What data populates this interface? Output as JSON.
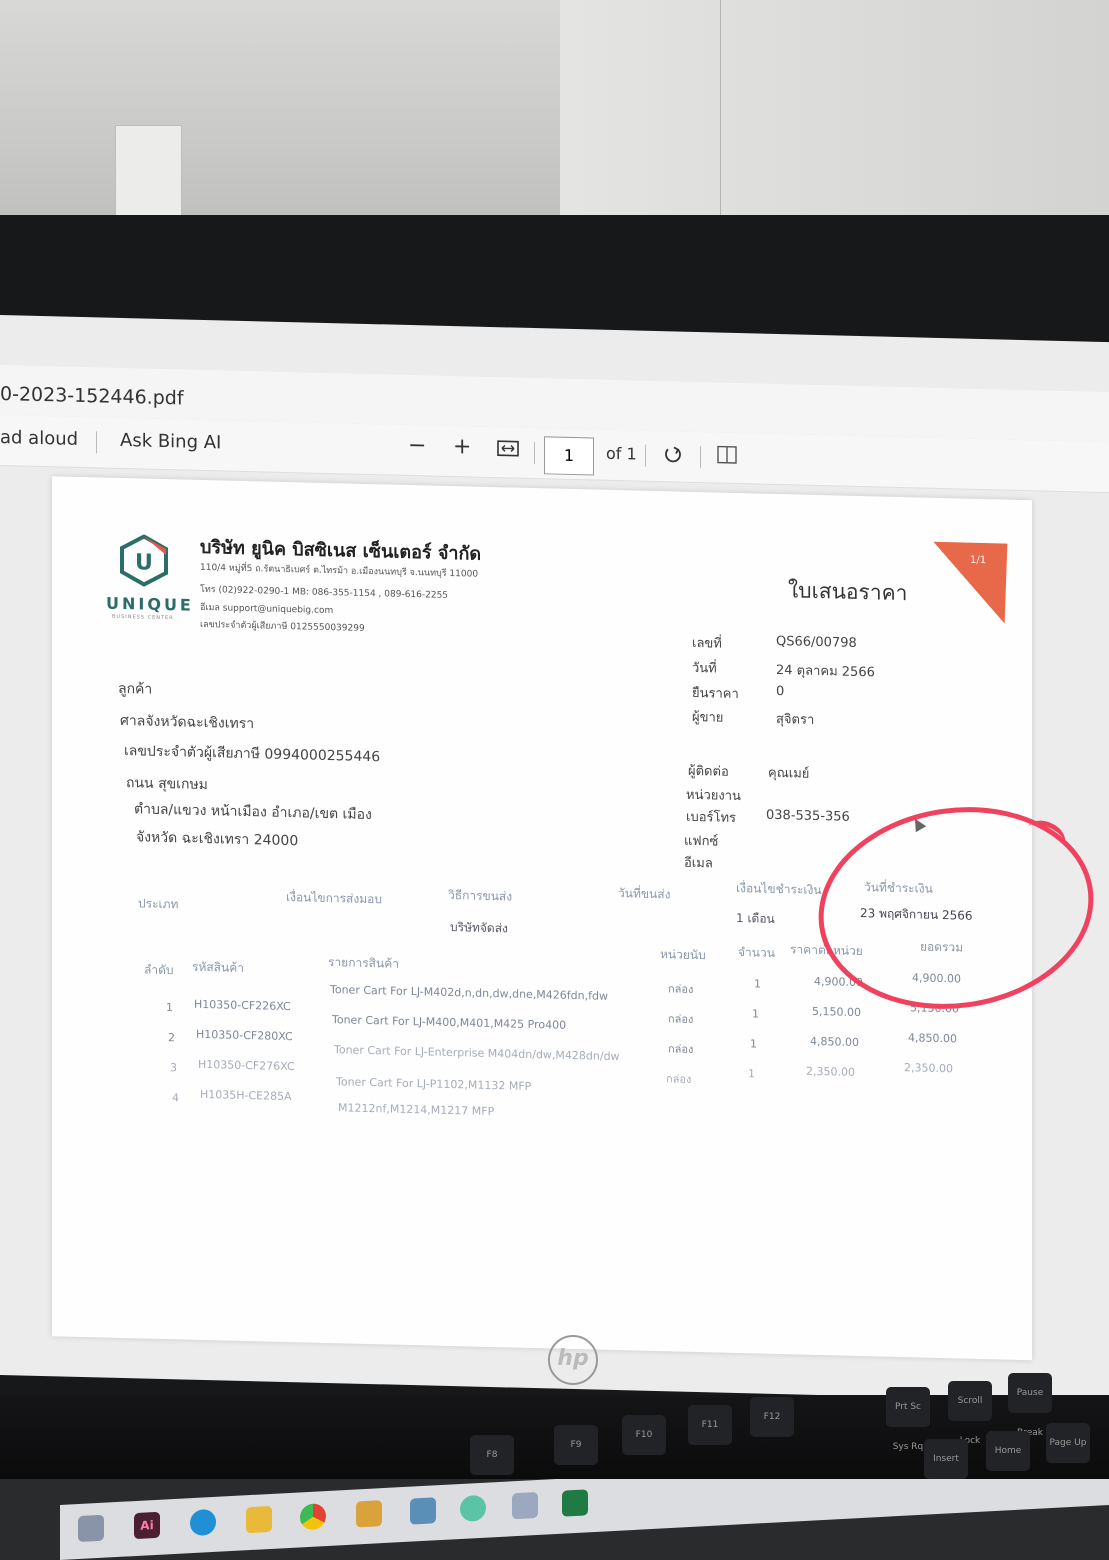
{
  "viewer": {
    "filename": "0-2023-152446.pdf",
    "read_aloud": "ad aloud",
    "ask_bing": "Ask Bing AI",
    "zoom_out": "−",
    "zoom_in": "+",
    "page_current": "1",
    "page_total": "of 1"
  },
  "doc": {
    "company_name": "บริษัท ยูนิค บิสซิเนส เซ็นเตอร์ จำกัด",
    "company_address": "110/4 หมู่ที่5 ถ.รัตนาธิเบศร์ ต.ไทรม้า อ.เมืองนนทบุรี จ.นนทบุรี 11000",
    "company_phone": "โทร   (02)922-0290-1  MB: 086-355-1154 , 089-616-2255",
    "company_email": "อีเมล  support@uniquebig.com",
    "company_taxid": "เลขประจำตัวผู้เสียภาษี   0125550039299",
    "logo_text": "UNIQUE",
    "logo_sub": "BUSINESS CENTER",
    "title": "ใบเสนอราคา",
    "page_badge": "1/1",
    "meta": [
      {
        "label": "เลขที่",
        "value": "QS66/00798"
      },
      {
        "label": "วันที่",
        "value": "24 ตุลาคม 2566"
      },
      {
        "label": "ยืนราคา",
        "value": "0"
      },
      {
        "label": "ผู้ขาย",
        "value": "สุจิตรา"
      }
    ],
    "contact": [
      {
        "label": "ผู้ติดต่อ",
        "value": "คุณเมย์"
      },
      {
        "label": "หน่วยงาน",
        "value": ""
      },
      {
        "label": "เบอร์โทร",
        "value": "038-535-356"
      },
      {
        "label": "แฟกซ์",
        "value": ""
      },
      {
        "label": "อีเมล",
        "value": ""
      }
    ],
    "customer": {
      "heading": "ลูกค้า",
      "name": "ศาลจังหวัดฉะเชิงเทรา",
      "taxid": "เลขประจำตัวผู้เสียภาษี  0994000255446",
      "road": "ถนน สุขเกษม",
      "district": "ตำบล/แขวง หน้าเมือง อำเภอ/เขต เมือง",
      "province": "จังหวัด ฉะเชิงเทรา 24000"
    },
    "terms_headers": {
      "type": "ประเภท",
      "delivery_cond": "เงื่อนไขการส่งมอบ",
      "shipping": "วิธีการขนส่ง",
      "ship_date": "วันที่ขนส่ง",
      "pay_cond": "เงื่อนไขชำระเงิน",
      "pay_date": "วันที่ชำระเงิน"
    },
    "terms_values": {
      "shipping": "บริษัทจัดส่ง",
      "pay_cond": "1 เดือน",
      "pay_date": "23 พฤศจิกายน 2566"
    },
    "item_headers": {
      "no": "ลำดับ",
      "code": "รหัสสินค้า",
      "desc": "รายการสินค้า",
      "unit": "หน่วยนับ",
      "qty": "จำนวน",
      "price": "ราคาต่อหน่วย",
      "total": "ยอดรวม"
    },
    "items": [
      {
        "no": "",
        "code": "",
        "desc": "Toner Cart For LJ-M402d,n,dn,dw,dne,M426fdn,fdw",
        "unit": "กล่อง",
        "qty": "1",
        "price": "4,900.00",
        "total": "4,900.00"
      },
      {
        "no": "1",
        "code": "H10350-CF226XC",
        "desc": "Toner Cart For LJ-M400,M401,M425 Pro400",
        "unit": "กล่อง",
        "qty": "1",
        "price": "5,150.00",
        "total": "5,150.00"
      },
      {
        "no": "2",
        "code": "H10350-CF280XC",
        "desc": "Toner Cart For LJ-Enterprise M404dn/dw,M428dn/dw",
        "unit": "กล่อง",
        "qty": "1",
        "price": "4,850.00",
        "total": "4,850.00"
      },
      {
        "no": "3",
        "code": "H10350-CF276XC",
        "desc": "Toner Cart For LJ-P1102,M1132 MFP",
        "unit": "กล่อง",
        "qty": "1",
        "price": "2,350.00",
        "total": "2,350.00"
      },
      {
        "no": "4",
        "code": "H1035H-CE285A",
        "desc": "M1212nf,M1214,M1217 MFP",
        "unit": "",
        "qty": "",
        "price": "",
        "total": ""
      }
    ]
  },
  "taskbar": {
    "icons": [
      "widgets-icon",
      "illustrator-icon",
      "edge-icon",
      "file-explorer-icon",
      "chrome-icon",
      "calendar-icon",
      "store-icon",
      "teams-icon",
      "cart-icon",
      "excel-icon"
    ],
    "ai_label": "Ai"
  },
  "monitor": {
    "brand": "hp"
  },
  "keys": [
    "F8",
    "F9",
    "F10",
    "F11",
    "F12",
    "Prt Sc Sys Rq",
    "Scroll Lock",
    "Pause Break",
    "Insert",
    "Home",
    "Page Up"
  ]
}
